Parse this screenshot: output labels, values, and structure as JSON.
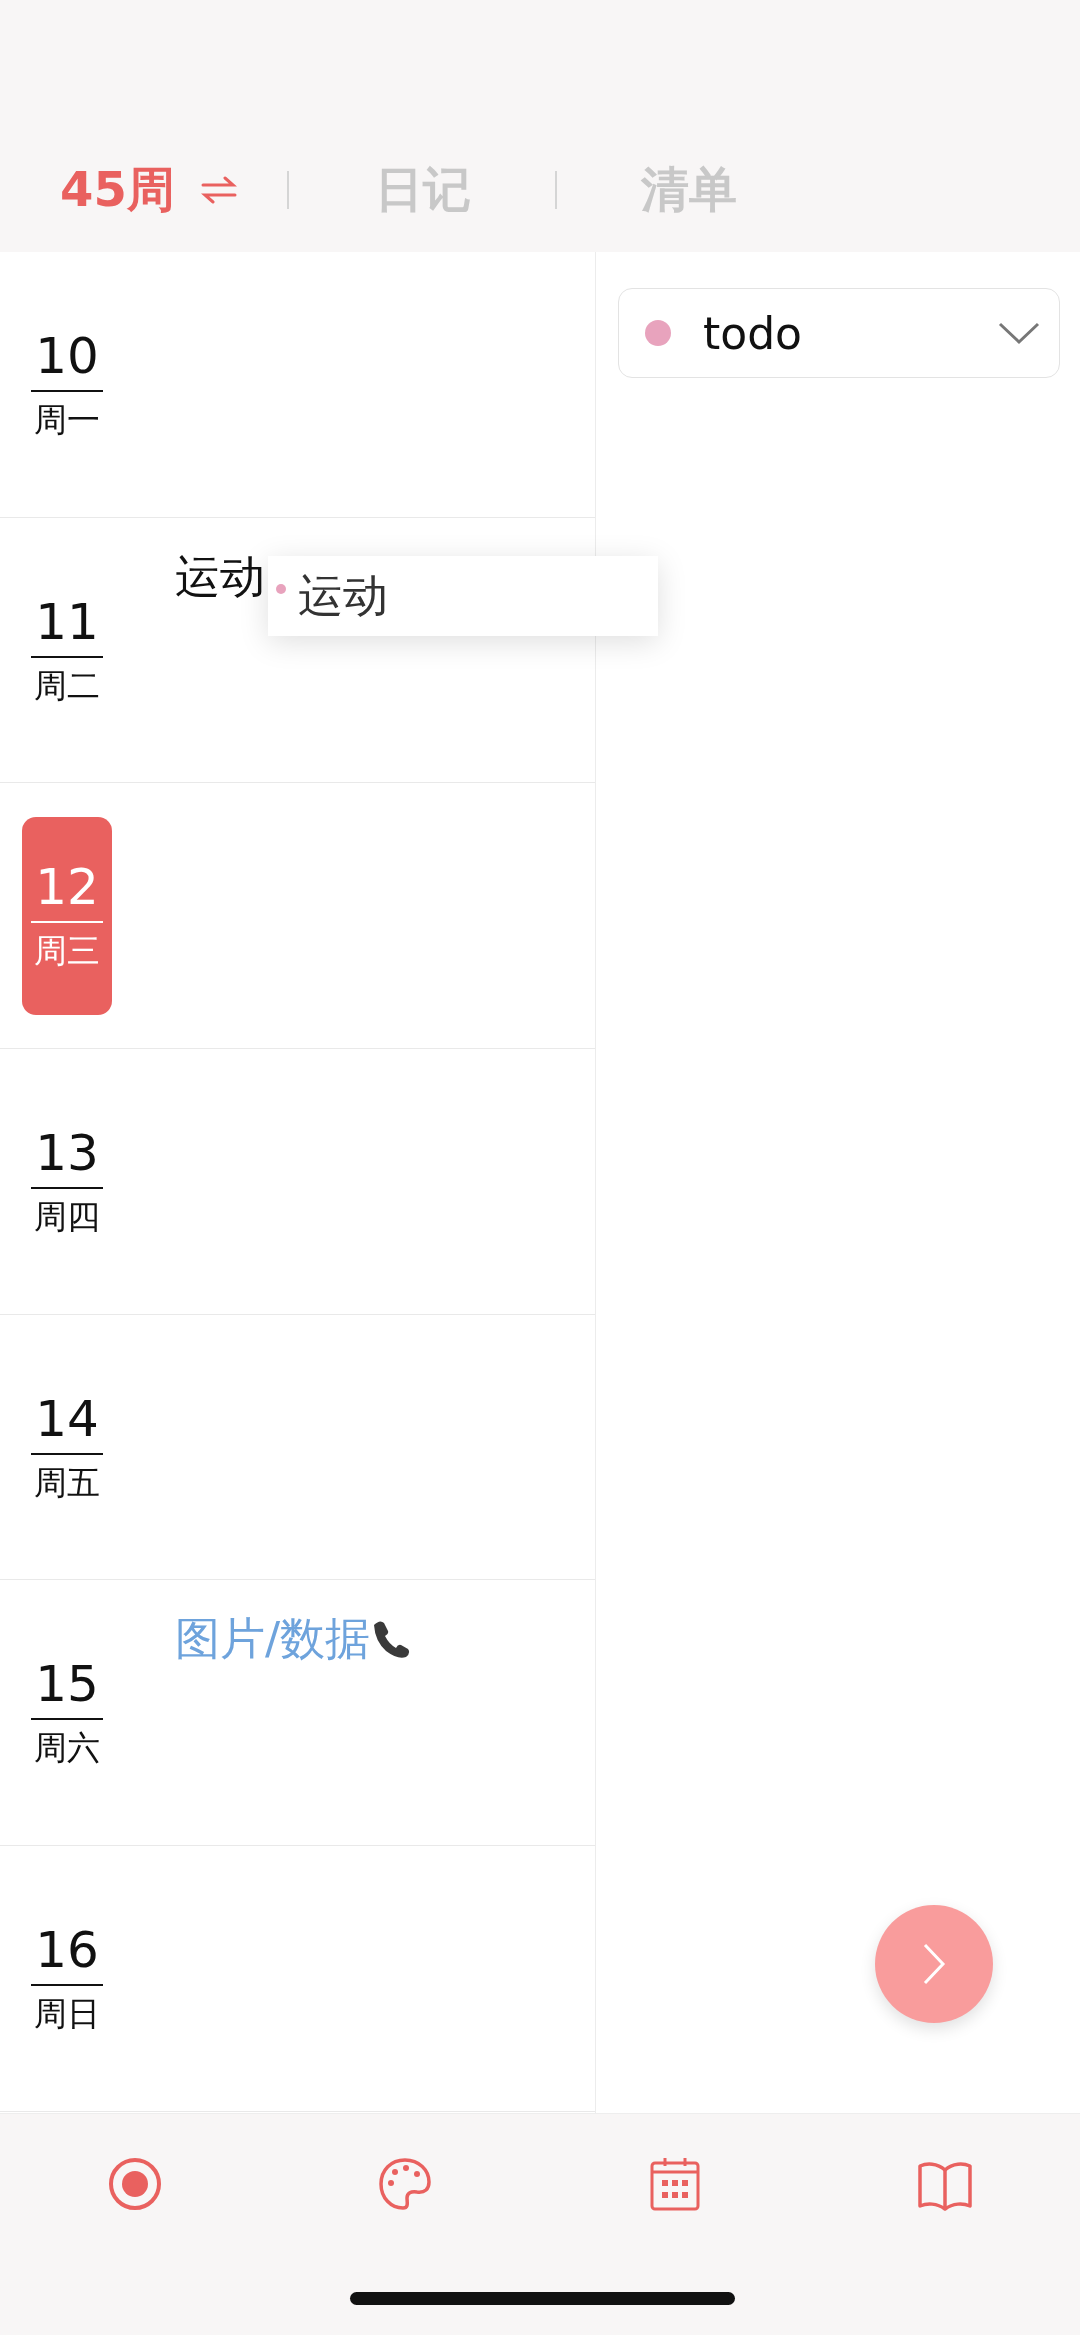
{
  "header": {
    "tabs": [
      {
        "label": "45周",
        "selected": true,
        "kind": "week"
      },
      {
        "label": "日记",
        "selected": false,
        "kind": "plain"
      },
      {
        "label": "清单",
        "selected": false,
        "kind": "plain"
      }
    ]
  },
  "days": [
    {
      "day": "10",
      "weekday": "周一",
      "today": false
    },
    {
      "day": "11",
      "weekday": "周二",
      "today": false,
      "events": [
        {
          "text": "运动",
          "kind": "plain"
        }
      ]
    },
    {
      "day": "12",
      "weekday": "周三",
      "today": true
    },
    {
      "day": "13",
      "weekday": "周四",
      "today": false
    },
    {
      "day": "14",
      "weekday": "周五",
      "today": false
    },
    {
      "day": "15",
      "weekday": "周六",
      "today": false,
      "events": [
        {
          "text": "图片/数据",
          "kind": "call"
        }
      ]
    },
    {
      "day": "16",
      "weekday": "周日",
      "today": false
    }
  ],
  "drag_preview": {
    "text": "运动",
    "color": "#e8a3bd"
  },
  "list_picker": {
    "value": "todo",
    "color": "#e8a3bd"
  },
  "bottom_tabs": [
    {
      "kind": "record"
    },
    {
      "kind": "palette"
    },
    {
      "kind": "calendar"
    },
    {
      "kind": "book"
    }
  ]
}
